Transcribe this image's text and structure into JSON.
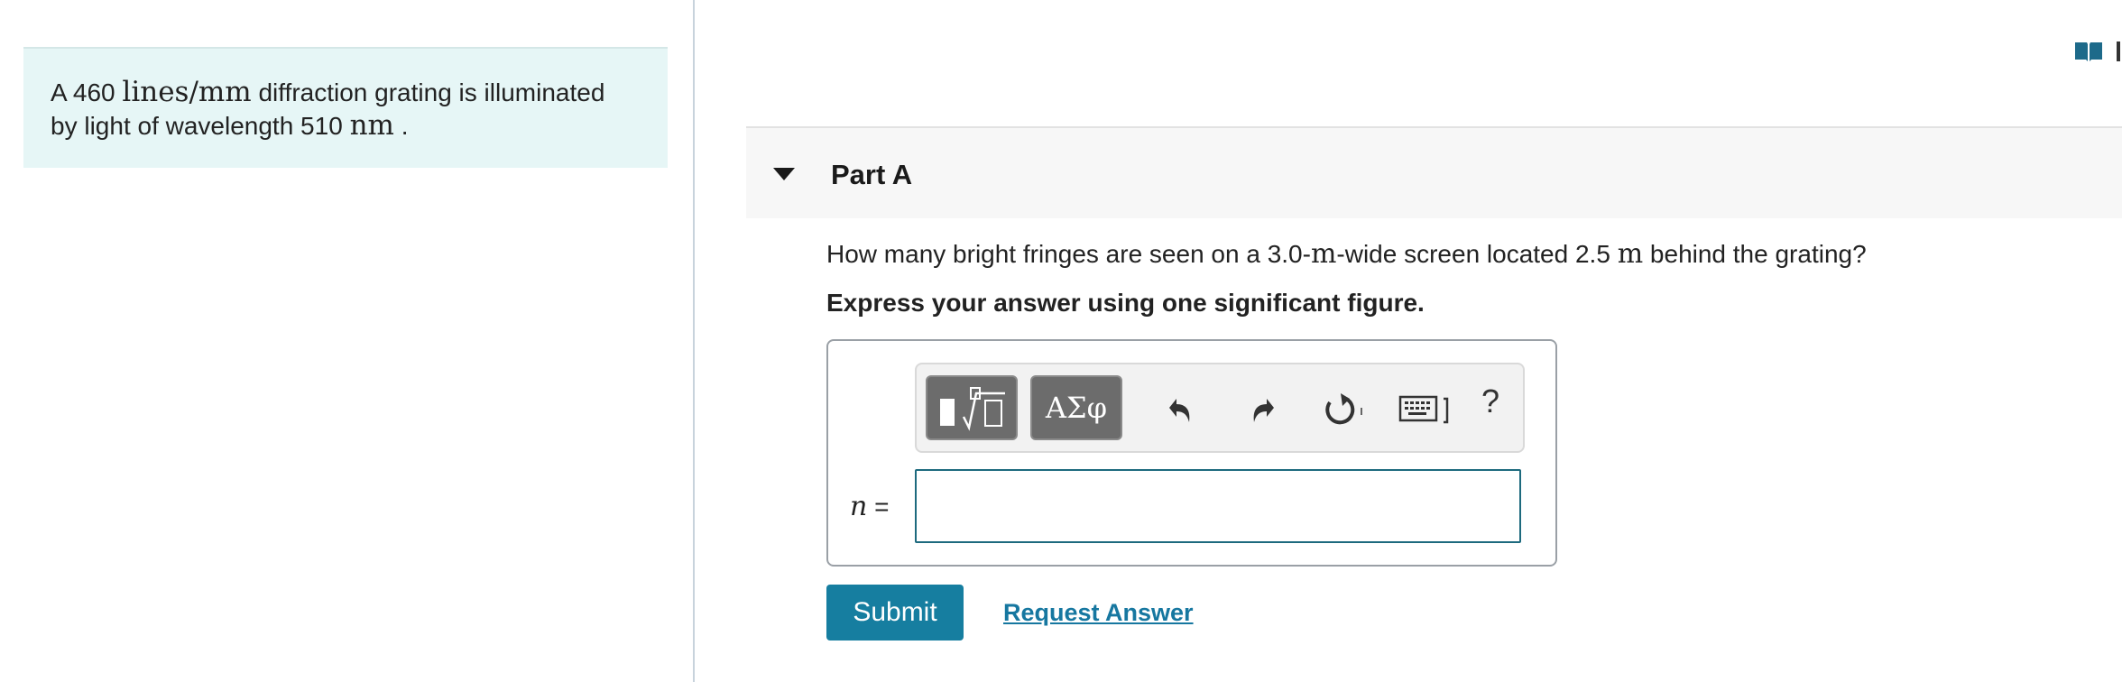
{
  "problem": {
    "intro_prefix": "A 460 ",
    "intro_unit": "lines/mm",
    "intro_mid": " diffraction grating is illuminated",
    "intro_line2_prefix": "by light of wavelength 510 ",
    "intro_line2_unit": "nm",
    "intro_line2_suffix": " ."
  },
  "part": {
    "title": "Part A",
    "question_prefix": "How many bright fringes are seen on a 3.0-",
    "question_unit1": "m",
    "question_mid": "-wide screen located 2.5 ",
    "question_unit2": "m",
    "question_suffix": " behind the grating?",
    "instruction": "Express your answer using one significant figure."
  },
  "answer": {
    "variable": "n",
    "equals": " =",
    "value": "",
    "placeholder": ""
  },
  "toolbar": {
    "greek_label": "ΑΣφ",
    "help_label": "?",
    "icons": [
      "templates-icon",
      "greek-symbols-icon",
      "undo-icon",
      "redo-icon",
      "reset-icon",
      "keyboard-icon",
      "help-icon"
    ]
  },
  "actions": {
    "submit_label": "Submit",
    "request_label": "Request Answer"
  },
  "colors": {
    "intro_bg": "#e6f6f6",
    "submit_bg": "#167ea0",
    "link": "#1677a0",
    "input_border": "#1d6a7e"
  }
}
